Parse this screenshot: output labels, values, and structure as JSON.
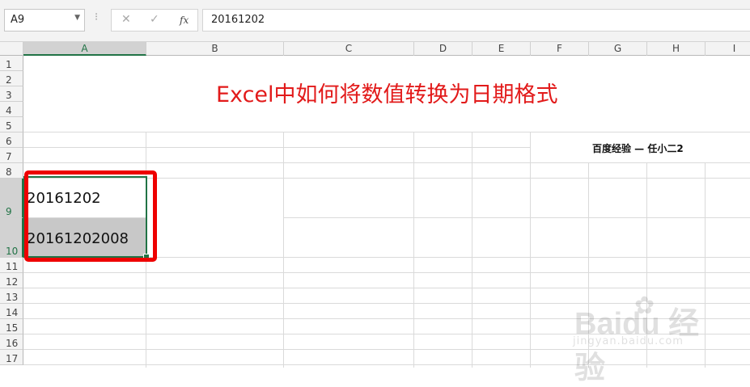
{
  "formula_bar": {
    "name_box": "A9",
    "cancel_icon": "✕",
    "enter_icon": "✓",
    "fx_label": "fx",
    "formula_value": "20161202"
  },
  "columns": [
    "A",
    "B",
    "C",
    "D",
    "E",
    "F",
    "G",
    "H",
    "I"
  ],
  "rows": [
    "1",
    "2",
    "3",
    "4",
    "5",
    "6",
    "7",
    "8",
    "9",
    "10",
    "11",
    "12",
    "13",
    "14",
    "15",
    "16",
    "17"
  ],
  "sheet": {
    "title": "Excel中如何将数值转换为日期格式",
    "author": "百度经验 — 任小二2",
    "cells": {
      "A9": "20161202",
      "A10": "20161202008"
    }
  },
  "watermark": {
    "brand": "Baidu 经验",
    "url": "jingyan.baidu.com"
  },
  "colors": {
    "title": "#e21a1a",
    "highlight_border": "#ee0000",
    "selection": "#217346",
    "selected_cell_fill": "#c8c8c8"
  }
}
